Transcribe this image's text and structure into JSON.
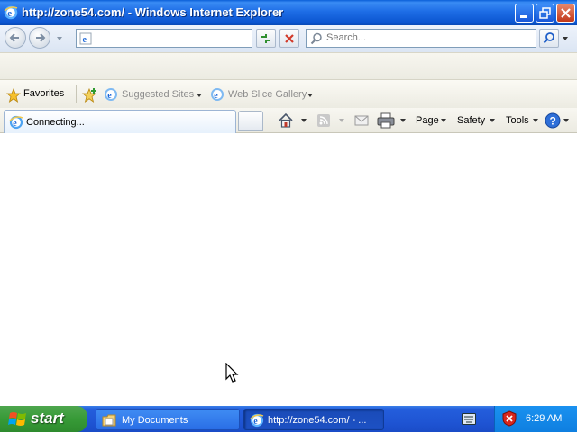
{
  "window": {
    "title": "http://zone54.com/ - Windows Internet Explorer"
  },
  "address_bar": {
    "value": "",
    "search_placeholder": "Search..."
  },
  "favorites_bar": {
    "favorites_label": "Favorites",
    "suggested_sites_label": "Suggested Sites",
    "web_slice_gallery_label": "Web Slice Gallery"
  },
  "tabs": [
    {
      "label": "Connecting...",
      "active": true
    }
  ],
  "command_bar": {
    "page_label": "Page",
    "safety_label": "Safety",
    "tools_label": "Tools"
  },
  "taskbar": {
    "start_label": "start",
    "tasks": [
      {
        "label": "My Documents"
      },
      {
        "label": "http://zone54.com/ - ..."
      }
    ],
    "clock": "6:29 AM"
  },
  "colors": {
    "titlebar_blue": "#0b55d0",
    "taskbar_blue": "#245edc",
    "start_green": "#379a37",
    "tray_blue": "#0f7fe0"
  }
}
